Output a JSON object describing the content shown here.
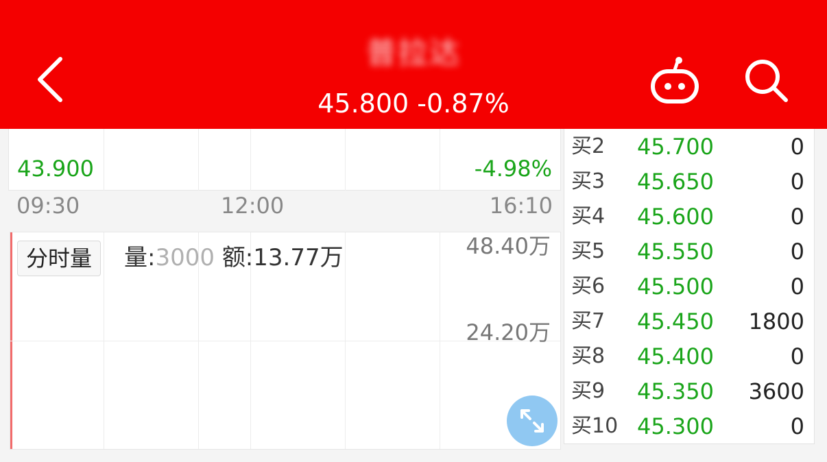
{
  "header": {
    "title": "普拉达",
    "price_line": "45.800 -0.87%",
    "colors": {
      "background": "#f40000",
      "text": "#ffffff"
    },
    "icons": [
      "chevron-left-icon",
      "robot-icon",
      "search-icon"
    ]
  },
  "chart": {
    "low_price": "43.900",
    "low_pct": "-4.98%",
    "time_labels": [
      "09:30",
      "12:00",
      "16:10"
    ],
    "volume_tab": "分时量",
    "volume_label": "量:",
    "volume_value": "3000",
    "amount_text": "额:13.77万",
    "vol_max": "48.40万",
    "vol_mid": "24.20万",
    "colors": {
      "down": "#1aa51a"
    }
  },
  "order_book": {
    "rows": [
      {
        "label": "买2",
        "price": "45.700",
        "volume": "0"
      },
      {
        "label": "买3",
        "price": "45.650",
        "volume": "0"
      },
      {
        "label": "买4",
        "price": "45.600",
        "volume": "0"
      },
      {
        "label": "买5",
        "price": "45.550",
        "volume": "0"
      },
      {
        "label": "买6",
        "price": "45.500",
        "volume": "0"
      },
      {
        "label": "买7",
        "price": "45.450",
        "volume": "1800"
      },
      {
        "label": "买8",
        "price": "45.400",
        "volume": "0"
      },
      {
        "label": "买9",
        "price": "45.350",
        "volume": "3600"
      },
      {
        "label": "买10",
        "price": "45.300",
        "volume": "0"
      }
    ]
  }
}
